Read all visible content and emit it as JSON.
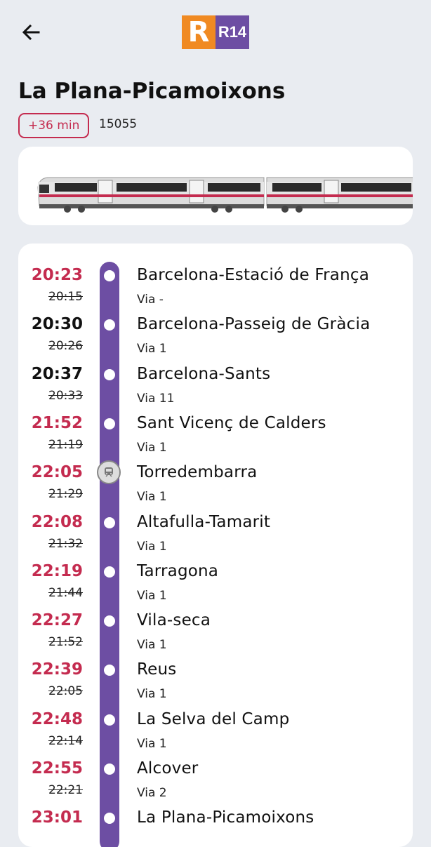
{
  "header": {
    "back_icon": "arrow-left-icon",
    "logo_letter": "R",
    "line": "R14"
  },
  "route": {
    "title": "La Plana-Picamoixons",
    "delay": "+36 min",
    "train_number": "15055"
  },
  "colors": {
    "accent": "#6d4ea3",
    "delay": "#c42b4f",
    "brand": "#f08a22"
  },
  "stops": [
    {
      "actual": "20:23",
      "scheduled": "20:15",
      "station": "Barcelona-Estació de França",
      "platform": "Via -",
      "late": true
    },
    {
      "actual": "20:30",
      "scheduled": "20:26",
      "station": "Barcelona-Passeig de Gràcia",
      "platform": "Via 1",
      "late": false
    },
    {
      "actual": "20:37",
      "scheduled": "20:33",
      "station": "Barcelona-Sants",
      "platform": "Via 11",
      "late": false
    },
    {
      "actual": "21:52",
      "scheduled": "21:19",
      "station": "Sant Vicenç de Calders",
      "platform": "Via 1",
      "late": true
    },
    {
      "actual": "22:05",
      "scheduled": "21:29",
      "station": "Torredembarra",
      "platform": "Via 1",
      "late": true,
      "current": true
    },
    {
      "actual": "22:08",
      "scheduled": "21:32",
      "station": "Altafulla-Tamarit",
      "platform": "Via 1",
      "late": true
    },
    {
      "actual": "22:19",
      "scheduled": "21:44",
      "station": "Tarragona",
      "platform": "Via 1",
      "late": true
    },
    {
      "actual": "22:27",
      "scheduled": "21:52",
      "station": "Vila-seca",
      "platform": "Via 1",
      "late": true
    },
    {
      "actual": "22:39",
      "scheduled": "22:05",
      "station": "Reus",
      "platform": "Via 1",
      "late": true
    },
    {
      "actual": "22:48",
      "scheduled": "22:14",
      "station": "La Selva del Camp",
      "platform": "Via 1",
      "late": true
    },
    {
      "actual": "22:55",
      "scheduled": "22:21",
      "station": "Alcover",
      "platform": "Via 2",
      "late": true
    },
    {
      "actual": "23:01",
      "scheduled": "",
      "station": "La Plana-Picamoixons",
      "platform": "",
      "late": true
    }
  ]
}
